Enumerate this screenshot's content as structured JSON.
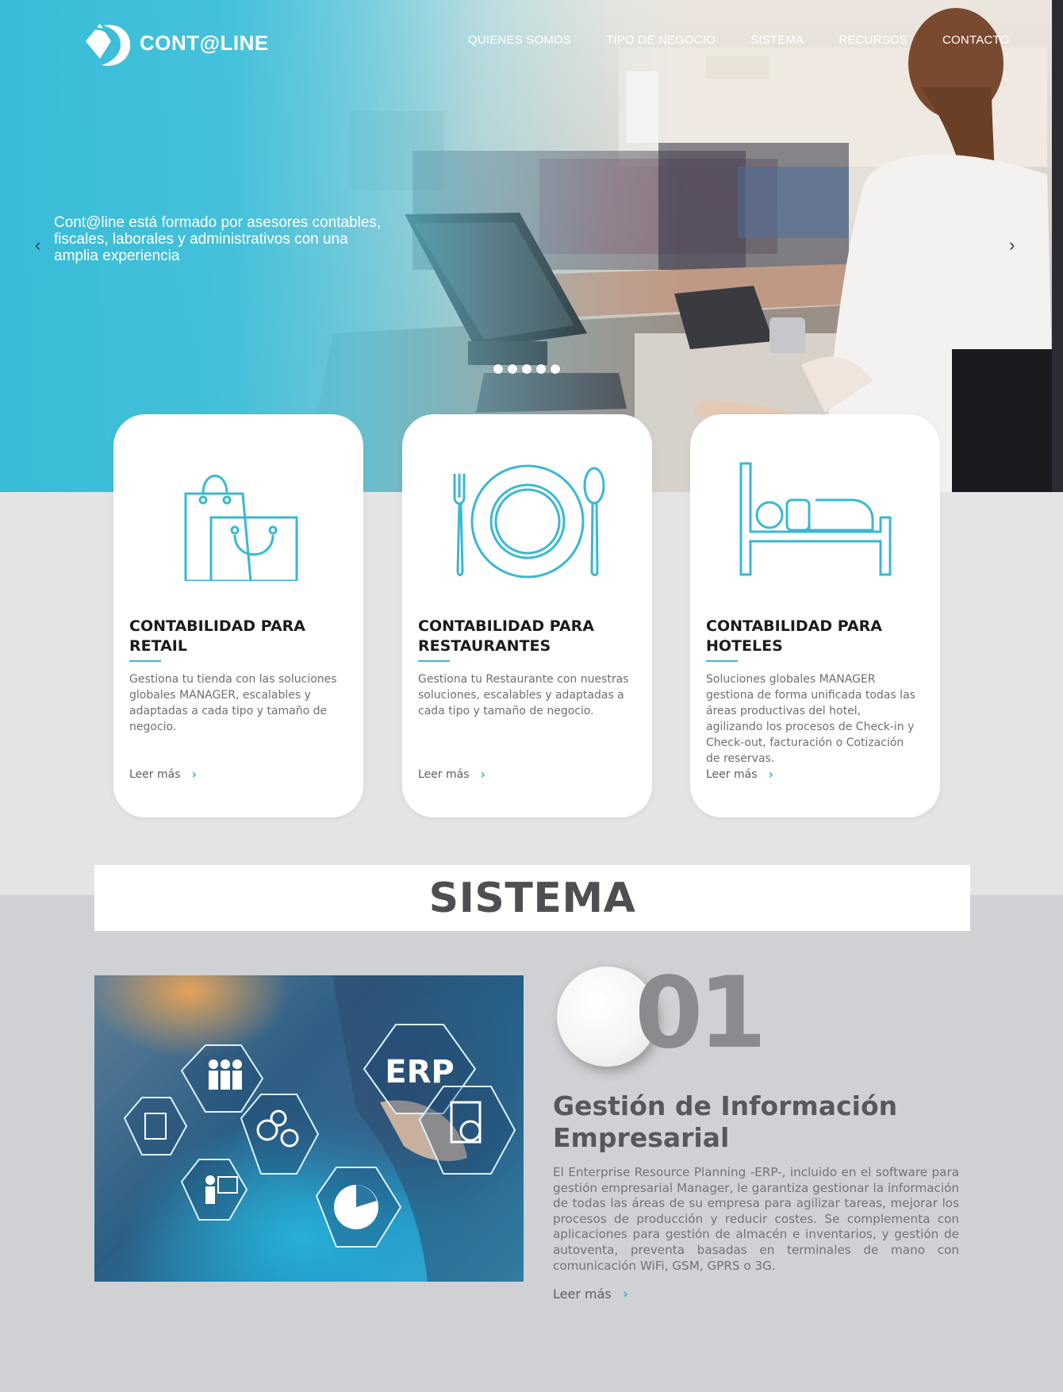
{
  "header": {
    "logo_text": "CONT@LINE",
    "nav": [
      {
        "label": "QUIENES SOMOS"
      },
      {
        "label": "TIPO DE NEGOCIO"
      },
      {
        "label": "SISTEMA"
      },
      {
        "label": "RECURSOS"
      },
      {
        "label": "CONTACTO"
      }
    ]
  },
  "hero": {
    "caption": "Cont@line está formado por asesores contables, fiscales, laborales y administrativos con una amplia experiencia",
    "prev_icon": "chevron-left-icon",
    "next_icon": "chevron-right-icon",
    "slides": 5,
    "active_slide": 1
  },
  "cards": [
    {
      "icon": "shopping-bags-icon",
      "title": "CONTABILIDAD PARA RETAIL",
      "text": "Gestiona tu tienda con las soluciones globales MANAGER, escalables y adaptadas a cada tipo y tamaño de negocio.",
      "more": "Leer más"
    },
    {
      "icon": "plate-cutlery-icon",
      "title": "CONTABILIDAD PARA RESTAURANTES",
      "text": "Gestiona tu Restaurante con nuestras soluciones, escalables y adaptadas a cada tipo y tamaño de negocio.",
      "more": "Leer más"
    },
    {
      "icon": "bed-icon",
      "title": "CONTABILIDAD PARA HOTELES",
      "text": "Soluciones globales MANAGER gestiona de forma unificada todas las áreas productivas del hotel, agilizando los procesos de Check-in y Check-out, facturación o Cotización de reservas.",
      "more": "Leer más"
    }
  ],
  "sistema": {
    "title": "SISTEMA",
    "image_label": "ERP",
    "number": "01",
    "heading": "Gestión de Información Empresarial",
    "body": "El Enterprise Resource Planning -ERP-, incluido en el software para gestión empresarial Manager, le garantiza gestionar la información de todas las áreas de su empresa para agilizar tareas, mejorar los procesos de producción y reducir costes. Se complementa con aplicaciones para gestión de almacén e inventarios, y gestión de autoventa, preventa basadas en terminales de mano con comunicación WiFi, GSM, GPRS o 3G.",
    "more": "Leer más"
  },
  "colors": {
    "accent": "#3ab8d2",
    "hero_cyan": "#38bcd7",
    "band_light": "#e4e4e6",
    "band_dark": "#d0d1d4"
  }
}
